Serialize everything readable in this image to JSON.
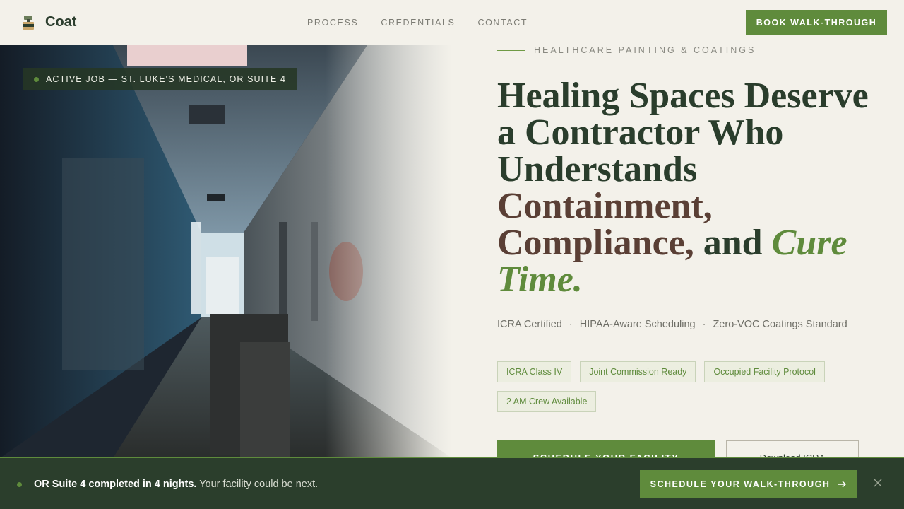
{
  "header": {
    "brand": "Coat",
    "nav": [
      "PROCESS",
      "CREDENTIALS",
      "CONTACT"
    ],
    "cta": "BOOK WALK-THROUGH"
  },
  "hero": {
    "job_badge": "ACTIVE JOB — ST. LUKE'S MEDICAL, OR SUITE 4",
    "eyebrow": "HEALTHCARE PAINTING & COATINGS",
    "headline": {
      "line1": "Healing Spaces Deserve",
      "line2": "a Contractor Who",
      "line3": "Understands",
      "line4": "Containment,",
      "line5a": "Compliance,",
      "line5b": "and",
      "line5c": "Cure",
      "line6": "Time."
    },
    "credentials": [
      "ICRA Certified",
      "HIPAA-Aware Scheduling",
      "Zero-VOC Coatings Standard"
    ],
    "separator": "·",
    "tags": [
      "ICRA Class IV",
      "Joint Commission Ready",
      "Occupied Facility Protocol",
      "2 AM Crew Available"
    ],
    "cta_primary": "SCHEDULE YOUR FACILITY",
    "cta_secondary": "Download ICRA"
  },
  "banner": {
    "bold": "OR Suite 4 completed in 4 nights.",
    "text": "Your facility could be next.",
    "cta": "SCHEDULE YOUR WALK-THROUGH",
    "cta_icon": "arrow-right-icon",
    "close_icon": "close-icon"
  },
  "colors": {
    "accent": "#5f8b3c",
    "dark": "#2b3e2c",
    "brown": "#5a3f35",
    "background": "#f3f1ea"
  }
}
